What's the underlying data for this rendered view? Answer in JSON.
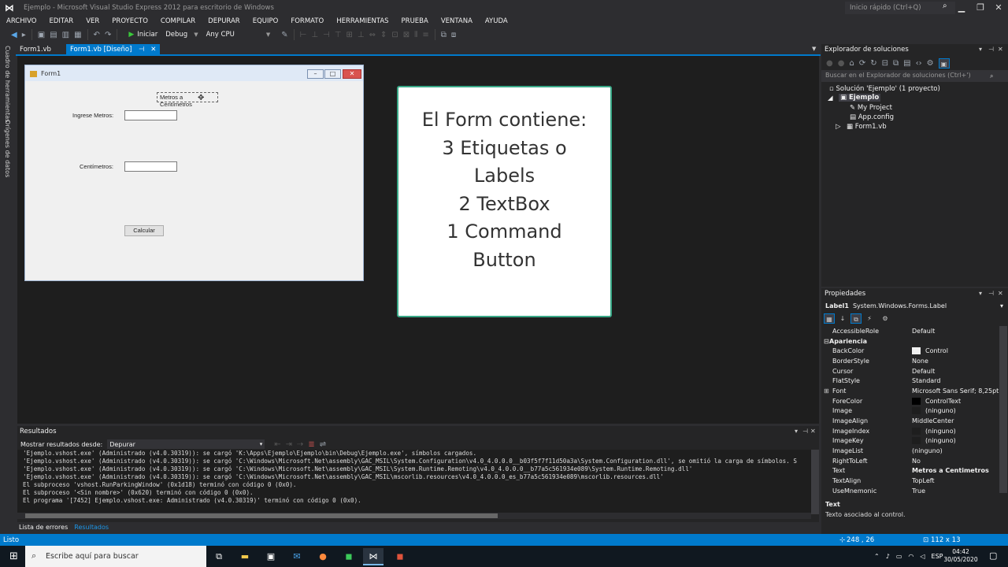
{
  "window": {
    "title": "Ejemplo - Microsoft Visual Studio Express 2012 para escritorio de Windows",
    "quick_launch_placeholder": "Inicio rápido (Ctrl+Q)",
    "minimize": "▁",
    "restore": "❐",
    "close": "✕"
  },
  "menu": [
    "ARCHIVO",
    "EDITAR",
    "VER",
    "PROYECTO",
    "COMPILAR",
    "DEPURAR",
    "EQUIPO",
    "FORMATO",
    "HERRAMIENTAS",
    "PRUEBA",
    "VENTANA",
    "AYUDA"
  ],
  "toolbar": {
    "start_label": "Iniciar",
    "config": "Debug",
    "platform": "Any CPU"
  },
  "left_strip": {
    "toolbox": "Cuadro de herramientas",
    "data_sources": "Orígenes de datos"
  },
  "doc_tabs": [
    {
      "label": "Form1.vb"
    },
    {
      "label": "Form1.vb [Diseño]",
      "pin": "⊣",
      "close": "✕"
    }
  ],
  "form": {
    "title": "Form1",
    "label_title": "Metros a Centímetros",
    "label_meters": "Ingrese Metros:",
    "label_cm": "Centímetros:",
    "button_label": "Calcular"
  },
  "info_card": {
    "lines": [
      "El Form contiene:",
      "3 Etiquetas o",
      "Labels",
      "2 TextBox",
      "1 Command",
      "Button"
    ]
  },
  "solution_explorer": {
    "title": "Explorador de soluciones",
    "search_placeholder": "Buscar en el Explorador de soluciones (Ctrl+')",
    "solution": "Solución 'Ejemplo'  (1 proyecto)",
    "project": "Ejemplo",
    "items": [
      "My Project",
      "App.config",
      "Form1.vb"
    ]
  },
  "properties": {
    "title": "Propiedades",
    "object_name": "Label1",
    "object_type": "System.Windows.Forms.Label",
    "rows": [
      {
        "name": "AccessibleRole",
        "value": "Default"
      },
      {
        "name": "Apariencia",
        "value": "",
        "category": true
      },
      {
        "name": "BackColor",
        "value": "Control",
        "swatch": "#f0f0f0"
      },
      {
        "name": "BorderStyle",
        "value": "None"
      },
      {
        "name": "Cursor",
        "value": "Default"
      },
      {
        "name": "FlatStyle",
        "value": "Standard"
      },
      {
        "name": "Font",
        "value": "Microsoft Sans Serif; 8,25pt",
        "expand": true
      },
      {
        "name": "ForeColor",
        "value": "ControlText",
        "swatch": "#000000"
      },
      {
        "name": "Image",
        "value": "(ninguno)",
        "swatch": "#1e1e1e"
      },
      {
        "name": "ImageAlign",
        "value": "MiddleCenter"
      },
      {
        "name": "ImageIndex",
        "value": "(ninguno)",
        "swatch": "#1e1e1e"
      },
      {
        "name": "ImageKey",
        "value": "(ninguno)",
        "swatch": "#1e1e1e"
      },
      {
        "name": "ImageList",
        "value": "(ninguno)"
      },
      {
        "name": "RightToLeft",
        "value": "No"
      },
      {
        "name": "Text",
        "value": "Metros a Centimetros",
        "bold": true
      },
      {
        "name": "TextAlign",
        "value": "TopLeft"
      },
      {
        "name": "UseMnemonic",
        "value": "True"
      }
    ],
    "desc_title": "Text",
    "desc_text": "Texto asociado al control."
  },
  "output": {
    "title": "Resultados",
    "source_label": "Mostrar resultados desde:",
    "source_value": "Depurar",
    "lines": [
      "'Ejemplo.vshost.exe' (Administrado (v4.0.30319)): se cargó 'K:\\Apps\\Ejemplo\\Ejemplo\\bin\\Debug\\Ejemplo.exe', símbolos cargados.",
      "'Ejemplo.vshost.exe' (Administrado (v4.0.30319)): se cargó 'C:\\Windows\\Microsoft.Net\\assembly\\GAC_MSIL\\System.Configuration\\v4.0_4.0.0.0__b03f5f7f11d50a3a\\System.Configuration.dll', se omitió la carga de símbolos. S",
      "'Ejemplo.vshost.exe' (Administrado (v4.0.30319)): se cargó 'C:\\Windows\\Microsoft.Net\\assembly\\GAC_MSIL\\System.Runtime.Remoting\\v4.0_4.0.0.0__b77a5c561934e089\\System.Runtime.Remoting.dll'",
      "'Ejemplo.vshost.exe' (Administrado (v4.0.30319)): se cargó 'C:\\Windows\\Microsoft.Net\\assembly\\GAC_MSIL\\mscorlib.resources\\v4.0_4.0.0.0_es_b77a5c561934e089\\mscorlib.resources.dll'",
      "El subproceso 'vshost.RunParkingWindow' (0x1d18) terminó con código 0 (0x0).",
      "El subproceso '<Sin nombre>' (0x620) terminó con código 0 (0x0).",
      "El programa '[7452] Ejemplo.vshost.exe: Administrado (v4.0.30319)' terminó con código 0 (0x0)."
    ]
  },
  "bottom_tabs": [
    "Lista de errores",
    "Resultados"
  ],
  "status": {
    "text": "Listo",
    "position": "248 , 26",
    "size": "112 x 13"
  },
  "taskbar": {
    "search_placeholder": "Escribe aquí para buscar",
    "lang": "ESP",
    "time": "04:42",
    "date": "30/05/2020"
  },
  "colors": {
    "accent": "#007acc",
    "card_border": "#39a887"
  }
}
